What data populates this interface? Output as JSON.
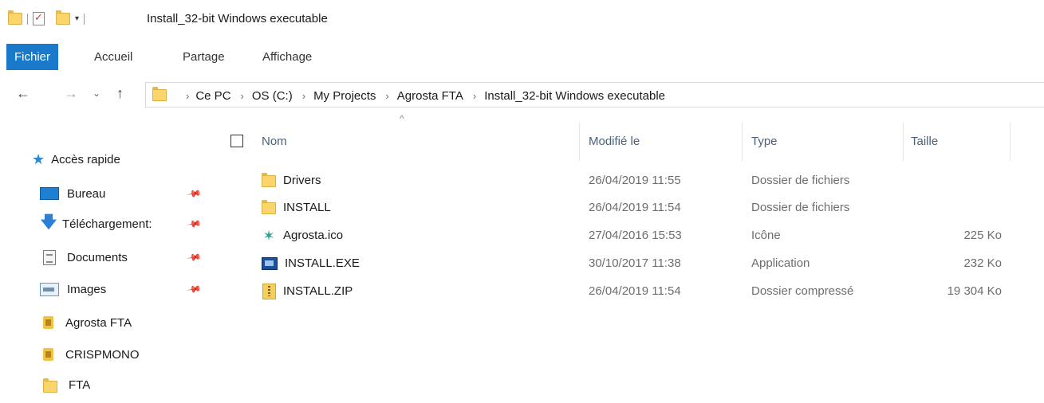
{
  "window": {
    "title": "Install_32-bit Windows executable"
  },
  "ribbon": {
    "tabs": [
      {
        "label": "Fichier",
        "active": true
      },
      {
        "label": "Accueil"
      },
      {
        "label": "Partage"
      },
      {
        "label": "Affichage"
      }
    ]
  },
  "address": {
    "crumbs": [
      "Ce PC",
      "OS (C:)",
      "My Projects",
      "Agrosta FTA",
      "Install_32-bit Windows executable"
    ]
  },
  "sidebar": {
    "header": "Accès rapide",
    "items": [
      {
        "label": "Bureau",
        "icon": "desktop-icon",
        "pinned": true
      },
      {
        "label": "Téléchargement:",
        "icon": "download-icon",
        "pinned": true
      },
      {
        "label": "Documents",
        "icon": "documents-icon",
        "pinned": true
      },
      {
        "label": "Images",
        "icon": "images-icon",
        "pinned": true
      },
      {
        "label": "Agrosta FTA",
        "icon": "app-folder-icon",
        "pinned": false
      },
      {
        "label": "CRISPMONO",
        "icon": "app-folder-icon",
        "pinned": false
      },
      {
        "label": "FTA",
        "icon": "folder-icon",
        "pinned": false
      }
    ]
  },
  "columns": {
    "name": "Nom",
    "modified": "Modifié le",
    "type": "Type",
    "size": "Taille"
  },
  "files": [
    {
      "name": "Drivers",
      "modified": "26/04/2019 11:55",
      "type": "Dossier de fichiers",
      "size": "",
      "icon": "folder-icon"
    },
    {
      "name": "INSTALL",
      "modified": "26/04/2019 11:54",
      "type": "Dossier de fichiers",
      "size": "",
      "icon": "folder-icon"
    },
    {
      "name": "Agrosta.ico",
      "modified": "27/04/2016 15:53",
      "type": "Icône",
      "size": "225 Ko",
      "icon": "ico-file-icon"
    },
    {
      "name": "INSTALL.EXE",
      "modified": "30/10/2017 11:38",
      "type": "Application",
      "size": "232 Ko",
      "icon": "exe-file-icon"
    },
    {
      "name": "INSTALL.ZIP",
      "modified": "26/04/2019 11:54",
      "type": "Dossier compressé",
      "size": "19 304 Ko",
      "icon": "zip-file-icon"
    }
  ]
}
